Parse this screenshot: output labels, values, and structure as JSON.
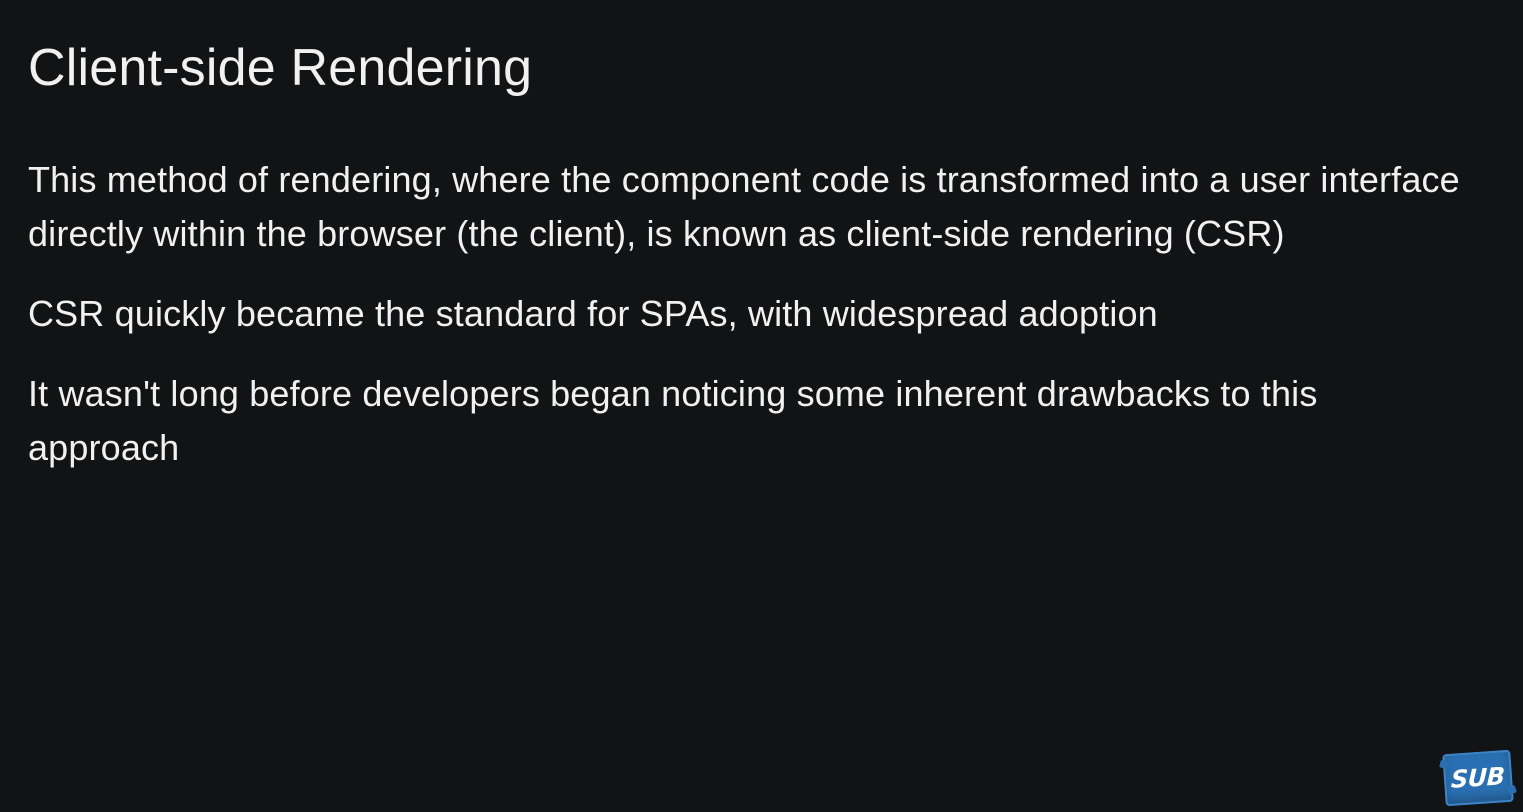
{
  "slide": {
    "title": "Client-side Rendering",
    "paragraphs": [
      "This method of rendering, where the component code is transformed into a user interface directly within the browser (the client), is known as client-side rendering (CSR)",
      "CSR quickly became the standard for SPAs, with widespread adoption",
      "It wasn't long before developers began noticing some inherent drawbacks to this approach"
    ]
  },
  "badge": {
    "label": "SUB",
    "icon": "subscribe-badge-icon",
    "color": "#2a6fb1"
  },
  "colors": {
    "background": "#111314",
    "text": "#f1f1f1"
  }
}
